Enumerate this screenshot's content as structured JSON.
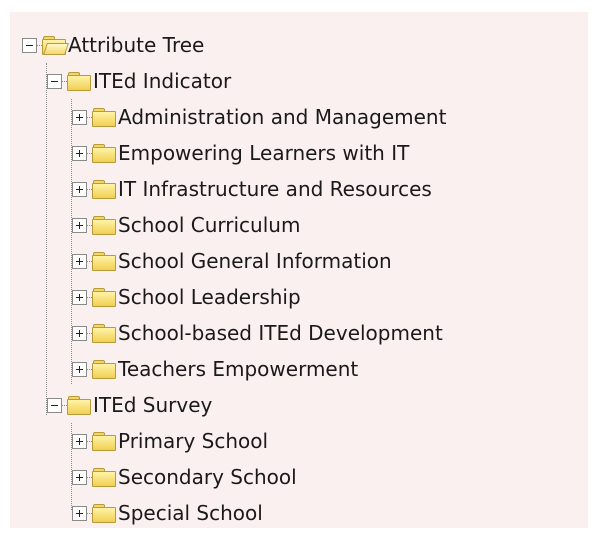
{
  "tree": {
    "root": {
      "label": "Attribute Tree",
      "expanded": true
    },
    "groups": [
      {
        "label": "ITEd Indicator",
        "expanded": true,
        "children": [
          "Administration and Management",
          "Empowering Learners with IT",
          "IT Infrastructure and Resources",
          "School Curriculum",
          "School General Information",
          "School Leadership",
          "School-based ITEd Development",
          "Teachers Empowerment"
        ]
      },
      {
        "label": "ITEd Survey",
        "expanded": true,
        "children": [
          "Primary School",
          "Secondary School",
          "Special School"
        ]
      }
    ]
  },
  "colors": {
    "panel_background": "#fbf0f0",
    "folder_fill": "#f0cf52",
    "folder_outline": "#b99a3a"
  }
}
